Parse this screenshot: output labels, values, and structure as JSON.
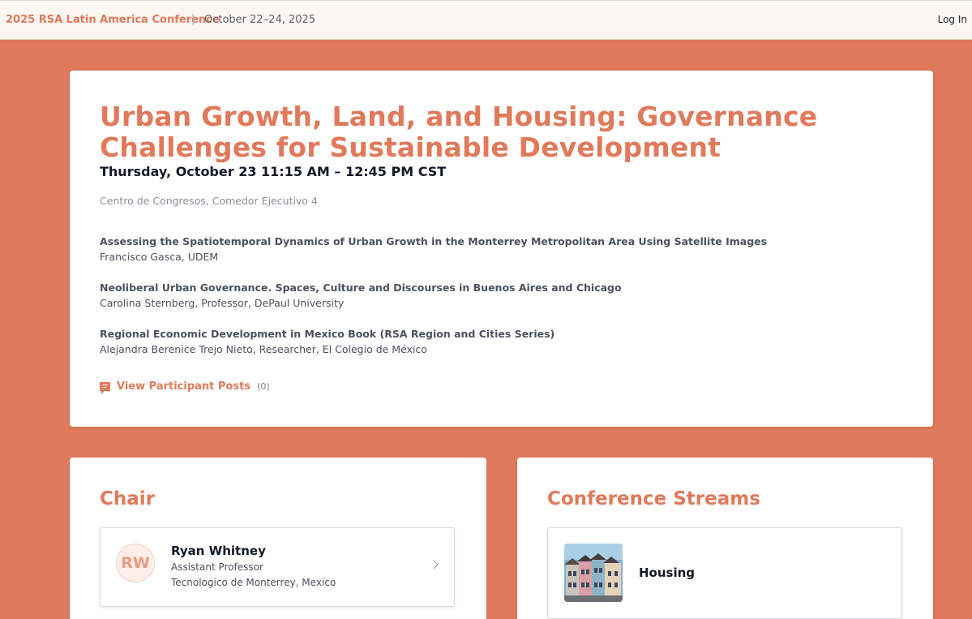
{
  "header": {
    "conference": "2025 RSA Latin America Conference",
    "separator": "|",
    "dates": "October 22–24, 2025",
    "login": "Log In"
  },
  "session": {
    "title": "Urban Growth, Land, and Housing: Governance Challenges for Sustainable Development",
    "time": "Thursday, October 23 11:15 AM – 12:45 PM CST",
    "room": "Centro de Congresos, Comedor Ejecutivo 4",
    "papers": [
      {
        "title": "Assessing the Spatiotemporal Dynamics of Urban Growth in the Monterrey Metropolitan Area Using Satellite Images",
        "author": "Francisco Gasca, UDEM"
      },
      {
        "title": "Neoliberal Urban Governance. Spaces, Culture and Discourses in Buenos Aires and Chicago",
        "author": "Carolina Sternberg, Professor, DePaul University"
      },
      {
        "title": "Regional Economic Development in Mexico Book (RSA Region and Cities Series)",
        "author": "Alejandra Berenice Trejo Nieto, Researcher, El Colegio de México"
      }
    ],
    "posts_label": "View Participant Posts",
    "posts_count": "(0)",
    "posts_icon": "comment-icon"
  },
  "chair": {
    "heading": "Chair",
    "initials": "RW",
    "name": "Ryan Whitney",
    "role": "Assistant Professor",
    "org": "Tecnologico de Monterrey, Mexico"
  },
  "streams": {
    "heading": "Conference Streams",
    "items": [
      {
        "label": "Housing"
      }
    ]
  },
  "colors": {
    "accent": "#e07a5a",
    "background": "#df7a5d",
    "header_bg": "#fdf7f4"
  }
}
